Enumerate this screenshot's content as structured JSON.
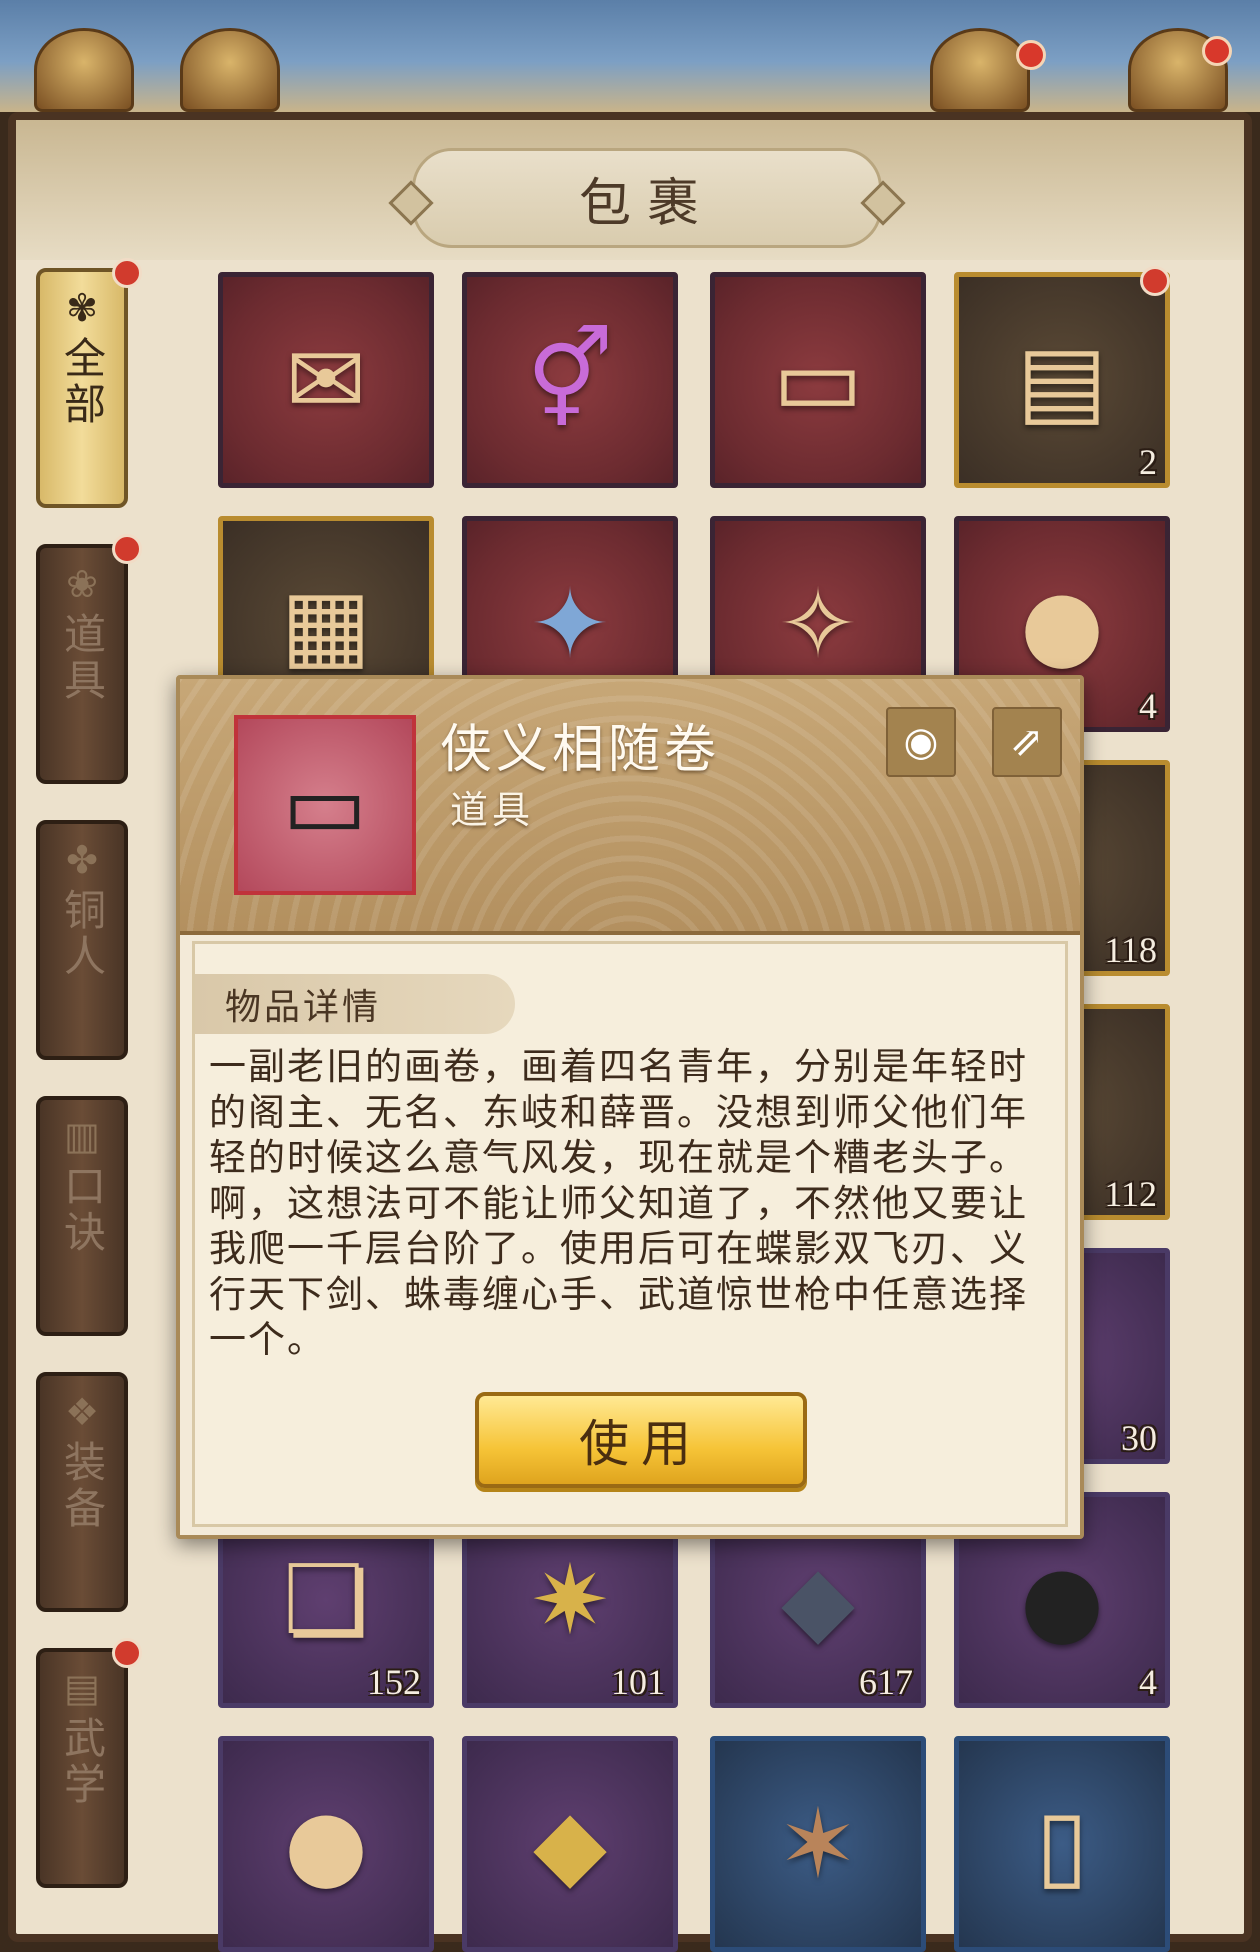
{
  "window": {
    "title": "包裹"
  },
  "side_tabs": [
    {
      "label": "全部",
      "icon": "fan-icon",
      "active": true,
      "badge": true
    },
    {
      "label": "道具",
      "icon": "pouch-icon",
      "active": false,
      "badge": true
    },
    {
      "label": "铜人",
      "icon": "bronze-figure-icon",
      "active": false,
      "badge": false
    },
    {
      "label": "口诀",
      "icon": "scroll-icon",
      "active": false,
      "badge": false
    },
    {
      "label": "装备",
      "icon": "armor-icon",
      "active": false,
      "badge": false
    },
    {
      "label": "武学",
      "icon": "book-icon",
      "active": false,
      "badge": true
    }
  ],
  "items": {
    "r1c4_count": "2",
    "r2c4_count": "4",
    "r3c4_count": "118",
    "r4c4_count": "112",
    "r5c4_count": "30",
    "r6c1_count": "152",
    "r6c2_count": "101",
    "r6c3_count": "617",
    "r6c4_count": "4"
  },
  "popup": {
    "name": "侠义相随卷",
    "type": "道具",
    "section_label": "物品详情",
    "description": "一副老旧的画卷，画着四名青年，分别是年轻时的阁主、无名、东岐和薛晋。没想到师父他们年轻的时候这么意气风发，现在就是个糟老头子。啊，这想法可不能让师父知道了，不然他又要让我爬一千层台阶了。使用后可在蝶影双飞刃、义行天下剑、蛛毒缠心手、武道惊世枪中任意选择一个。",
    "use_label": "使用"
  }
}
